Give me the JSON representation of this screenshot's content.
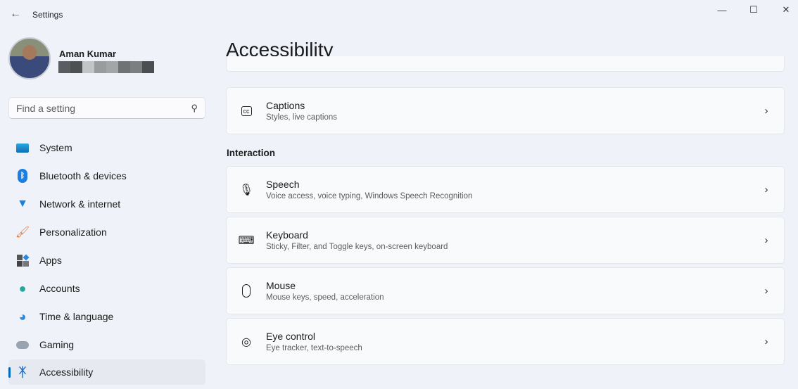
{
  "window": {
    "title": "Settings",
    "minimize": "—",
    "maximize": "☐",
    "close": "✕"
  },
  "user": {
    "name": "Aman Kumar"
  },
  "search": {
    "placeholder": "Find a setting"
  },
  "sidebar": {
    "items": [
      {
        "label": "System",
        "icon": "system-icon"
      },
      {
        "label": "Bluetooth & devices",
        "icon": "bluetooth-icon"
      },
      {
        "label": "Network & internet",
        "icon": "wifi-icon"
      },
      {
        "label": "Personalization",
        "icon": "brush-icon"
      },
      {
        "label": "Apps",
        "icon": "apps-icon"
      },
      {
        "label": "Accounts",
        "icon": "person-icon"
      },
      {
        "label": "Time & language",
        "icon": "globe-clock-icon"
      },
      {
        "label": "Gaming",
        "icon": "gamepad-icon"
      },
      {
        "label": "Accessibility",
        "icon": "accessibility-icon",
        "selected": true
      }
    ]
  },
  "main": {
    "title": "Accessibility",
    "section": "Interaction",
    "cards": [
      {
        "title": "Captions",
        "subtitle": "Styles, live captions",
        "icon": "cc-icon"
      },
      {
        "title": "Speech",
        "subtitle": "Voice access, voice typing, Windows Speech Recognition",
        "icon": "microphone-icon"
      },
      {
        "title": "Keyboard",
        "subtitle": "Sticky, Filter, and Toggle keys, on-screen keyboard",
        "icon": "keyboard-icon"
      },
      {
        "title": "Mouse",
        "subtitle": "Mouse keys, speed, acceleration",
        "icon": "mouse-icon"
      },
      {
        "title": "Eye control",
        "subtitle": "Eye tracker, text-to-speech",
        "icon": "eye-control-icon"
      }
    ]
  },
  "accent": "#0067c0"
}
